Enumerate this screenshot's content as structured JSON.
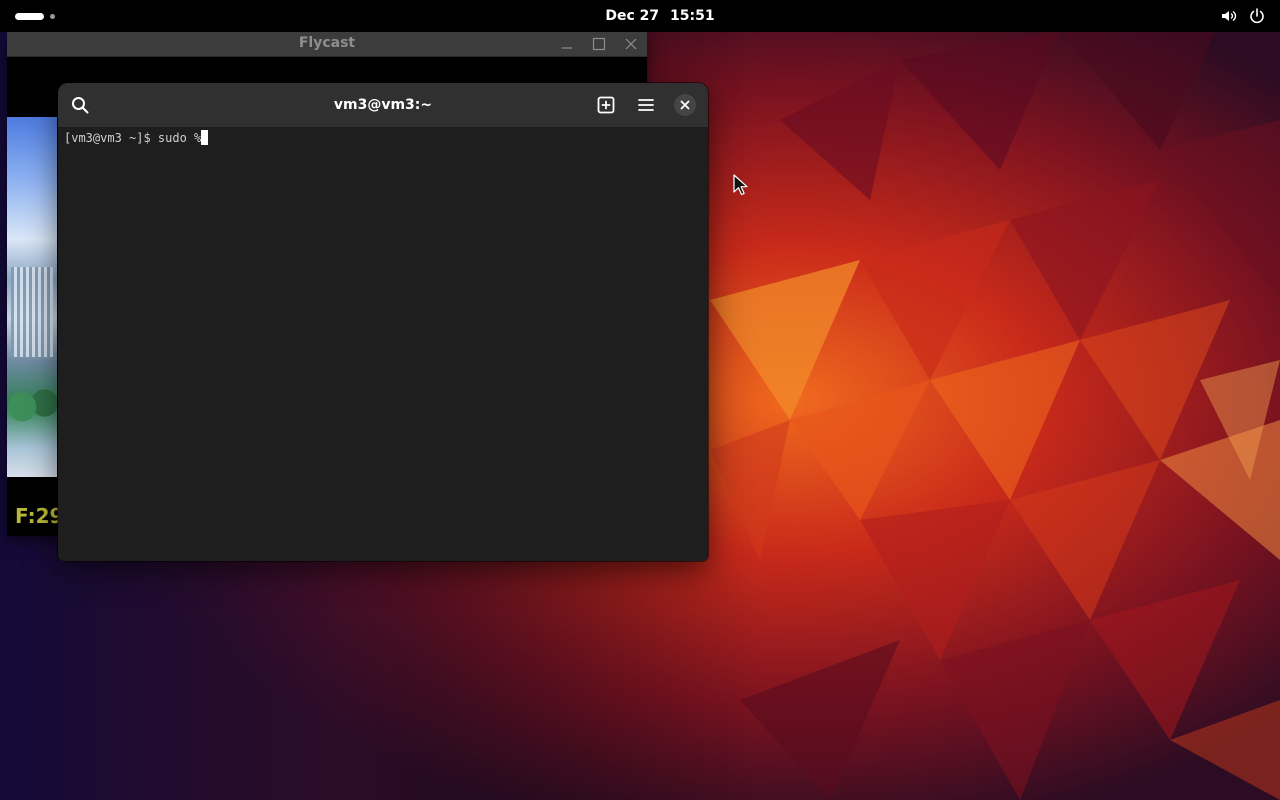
{
  "topbar": {
    "date": "Dec 27",
    "time": "15:51",
    "activities_icon": "workspace-indicator",
    "volume_icon": "speaker-icon",
    "power_icon": "power-icon"
  },
  "flycast": {
    "title": "Flycast",
    "fps_text": "F:29",
    "buttons": {
      "minimize": "minimize-icon",
      "maximize": "maximize-icon",
      "close": "close-icon"
    }
  },
  "terminal": {
    "title": "vm3@vm3:~",
    "prompt": "[vm3@vm3 ~]$ ",
    "input": "sudo %",
    "buttons": {
      "search": "search-icon",
      "new_tab": "new-tab-icon",
      "menu": "hamburger-menu-icon",
      "close": "close-icon"
    }
  },
  "colors": {
    "topbar_bg": "#000000",
    "terminal_bg": "#1e1e1e",
    "terminal_header": "#303030",
    "wallpaper_accent": "#d8401c"
  }
}
